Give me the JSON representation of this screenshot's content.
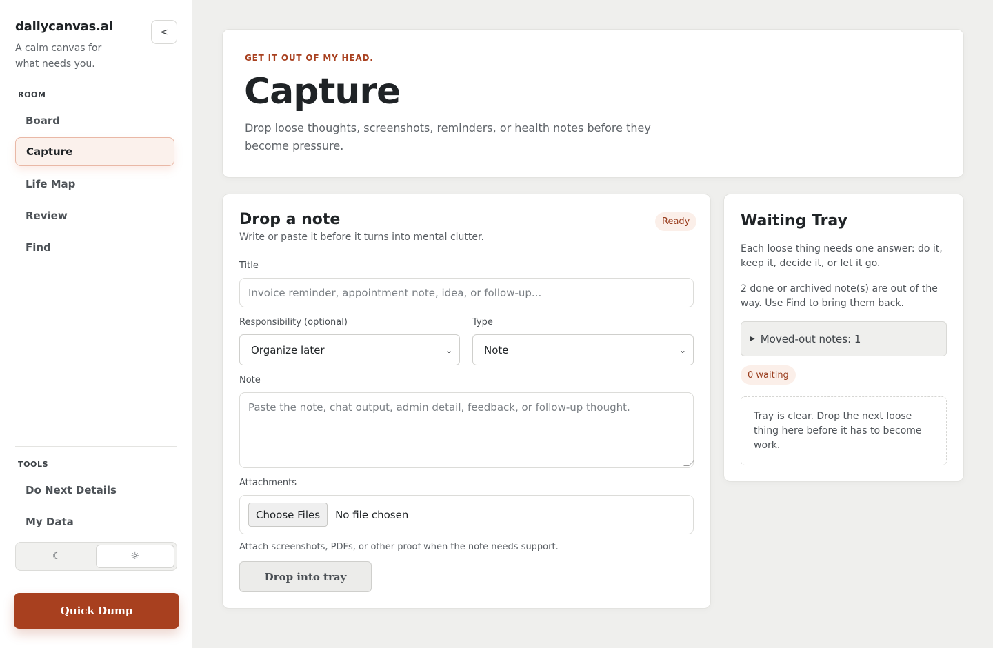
{
  "brand": {
    "name": "dailycanvas.ai",
    "tagline": "A calm canvas for what needs you.",
    "collapse_label": "<"
  },
  "sidebar": {
    "room_label": "ROOM",
    "room_items": [
      {
        "label": "Board"
      },
      {
        "label": "Capture",
        "active": true
      },
      {
        "label": "Life Map"
      },
      {
        "label": "Review"
      },
      {
        "label": "Find"
      }
    ],
    "tools_label": "TOOLS",
    "tool_items": [
      {
        "label": "Do Next Details"
      },
      {
        "label": "My Data"
      }
    ],
    "theme": {
      "dark_icon": "☾",
      "light_icon": "☼",
      "selected": "light"
    },
    "quick_dump_label": "Quick Dump"
  },
  "hero": {
    "eyebrow": "GET IT OUT OF MY HEAD.",
    "title": "Capture",
    "subtitle": "Drop loose thoughts, screenshots, reminders, or health notes before they become pressure."
  },
  "note_form": {
    "title": "Drop a note",
    "subtitle": "Write or paste it before it turns into mental clutter.",
    "status": "Ready",
    "title_label": "Title",
    "title_placeholder": "Invoice reminder, appointment note, idea, or follow-up...",
    "responsibility_label": "Responsibility (optional)",
    "responsibility_value": "Organize later",
    "type_label": "Type",
    "type_value": "Note",
    "note_label": "Note",
    "note_placeholder": "Paste the note, chat output, admin detail, feedback, or follow-up thought.",
    "attachments_label": "Attachments",
    "choose_files_label": "Choose Files",
    "file_status": "No file chosen",
    "attachments_hint": "Attach screenshots, PDFs, or other proof when the note needs support.",
    "submit_label": "Drop into tray"
  },
  "tray": {
    "title": "Waiting Tray",
    "description": "Each loose thing needs one answer: do it, keep it, decide it, or let it go.",
    "archived_note": "2 done or archived note(s) are out of the way. Use Find to bring them back.",
    "moved_out_label": "Moved-out notes: 1",
    "waiting_badge": "0 waiting",
    "empty_text": "Tray is clear. Drop the next loose thing here before it has to become work."
  },
  "colors": {
    "accent": "#a8401f",
    "badge_bg": "#fbefe9",
    "active_nav_bg": "#fbf1ec",
    "page_bg": "#efefed"
  }
}
